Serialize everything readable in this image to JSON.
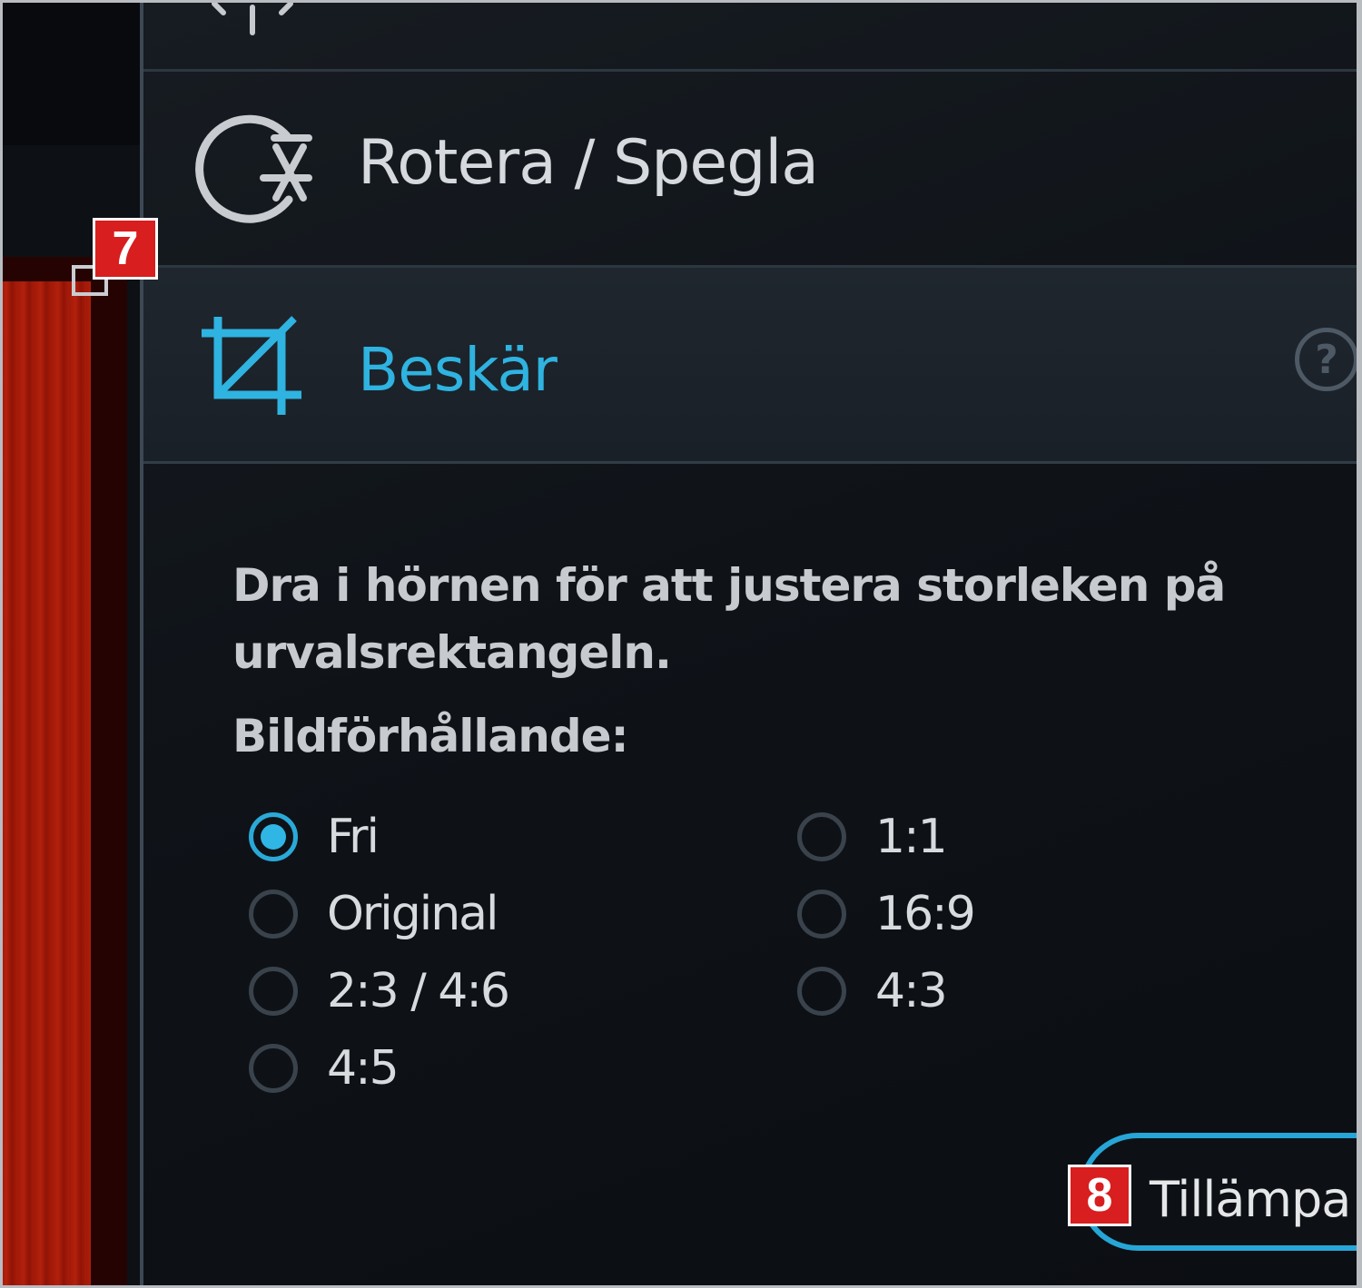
{
  "badges": {
    "crop_handle_step": "7",
    "apply_step": "8"
  },
  "panel": {
    "rotate_label": "Rotera / Spegla",
    "crop_label": "Beskär",
    "help_symbol": "?",
    "instructions": "Dra i hörnen för att justera storleken på urvalsrektangeln.",
    "aspect_title": "Bildförhållande:",
    "aspect_options": [
      {
        "label": "Fri",
        "selected": true
      },
      {
        "label": "Original",
        "selected": false
      },
      {
        "label": "2:3 / 4:6",
        "selected": false
      },
      {
        "label": "4:5",
        "selected": false
      },
      {
        "label": "1:1",
        "selected": false
      },
      {
        "label": "16:9",
        "selected": false
      },
      {
        "label": "4:3",
        "selected": false
      }
    ],
    "apply_label": "Tillämpa"
  },
  "icons": [
    "brightness-icon",
    "rotate-flip-icon",
    "crop-icon",
    "help-icon"
  ],
  "colors": {
    "accent": "#2fb3e0",
    "panel_bg": "#0f1318",
    "selected_row_bg": "#1f262e",
    "badge_red": "#d81e1e",
    "photo_red": "#a11a08"
  }
}
